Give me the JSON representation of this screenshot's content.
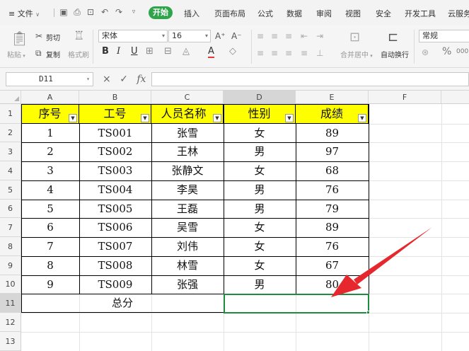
{
  "menu": {
    "app_menu_label": "≡ 文件",
    "tabs": [
      "开始",
      "插入",
      "页面布局",
      "公式",
      "数据",
      "审阅",
      "视图",
      "安全",
      "开发工具",
      "云服务"
    ],
    "active_tab": "开始",
    "accent_color": "#2fa54b"
  },
  "ribbon": {
    "paste_label": "粘贴",
    "cut_label": "剪切",
    "copy_label": "复制",
    "format_painter_label": "格式刷",
    "font_name": "宋体",
    "font_size": "16",
    "merge_label": "合并居中",
    "wrap_label": "自动换行",
    "number_format": "常规",
    "percent_symbol": "%",
    "thousands_symbol": "000"
  },
  "formula_bar": {
    "name_box": "D11",
    "cancel_symbol": "×",
    "confirm_symbol": "✓",
    "fx_label": "fx",
    "formula": ""
  },
  "sheet": {
    "columns": [
      "A",
      "B",
      "C",
      "D",
      "E",
      "F"
    ],
    "selected_column": "D",
    "rows": [
      "1",
      "2",
      "3",
      "4",
      "5",
      "6",
      "7",
      "8",
      "9",
      "10",
      "11",
      "12",
      "13"
    ],
    "selected_row": "11",
    "header_fill": "#ffff00",
    "headers": [
      "序号",
      "工号",
      "人员名称",
      "性别",
      "成绩"
    ],
    "data": [
      [
        "1",
        "TS001",
        "张雪",
        "女",
        "89"
      ],
      [
        "2",
        "TS002",
        "王林",
        "男",
        "97"
      ],
      [
        "3",
        "TS003",
        "张静文",
        "女",
        "68"
      ],
      [
        "4",
        "TS004",
        "李昊",
        "男",
        "76"
      ],
      [
        "5",
        "TS005",
        "王磊",
        "男",
        "79"
      ],
      [
        "6",
        "TS006",
        "吴雪",
        "女",
        "89"
      ],
      [
        "7",
        "TS007",
        "刘伟",
        "女",
        "76"
      ],
      [
        "8",
        "TS008",
        "林雪",
        "女",
        "67"
      ],
      [
        "9",
        "TS009",
        "张强",
        "男",
        "80"
      ]
    ],
    "total_label": "总分",
    "selection_color": "#1e8b3e",
    "annotation_arrow_color": "#e6272d"
  }
}
